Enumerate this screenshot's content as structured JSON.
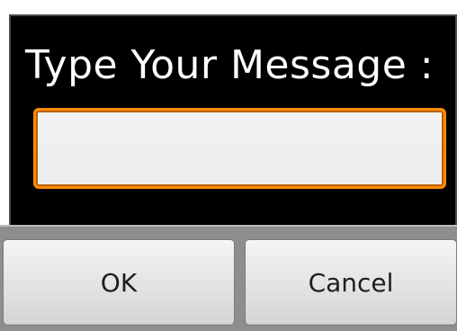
{
  "dialog": {
    "title": "Type Your Message :",
    "message_input": {
      "value": "",
      "placeholder": ""
    },
    "buttons": {
      "ok_label": "OK",
      "cancel_label": "Cancel"
    }
  },
  "colors": {
    "dialog_background": "#000000",
    "input_focus_border": "#ff8a00",
    "button_bar": "#8e8e8e",
    "button_face": "#e3e3e3",
    "title_text": "#ffffff"
  }
}
